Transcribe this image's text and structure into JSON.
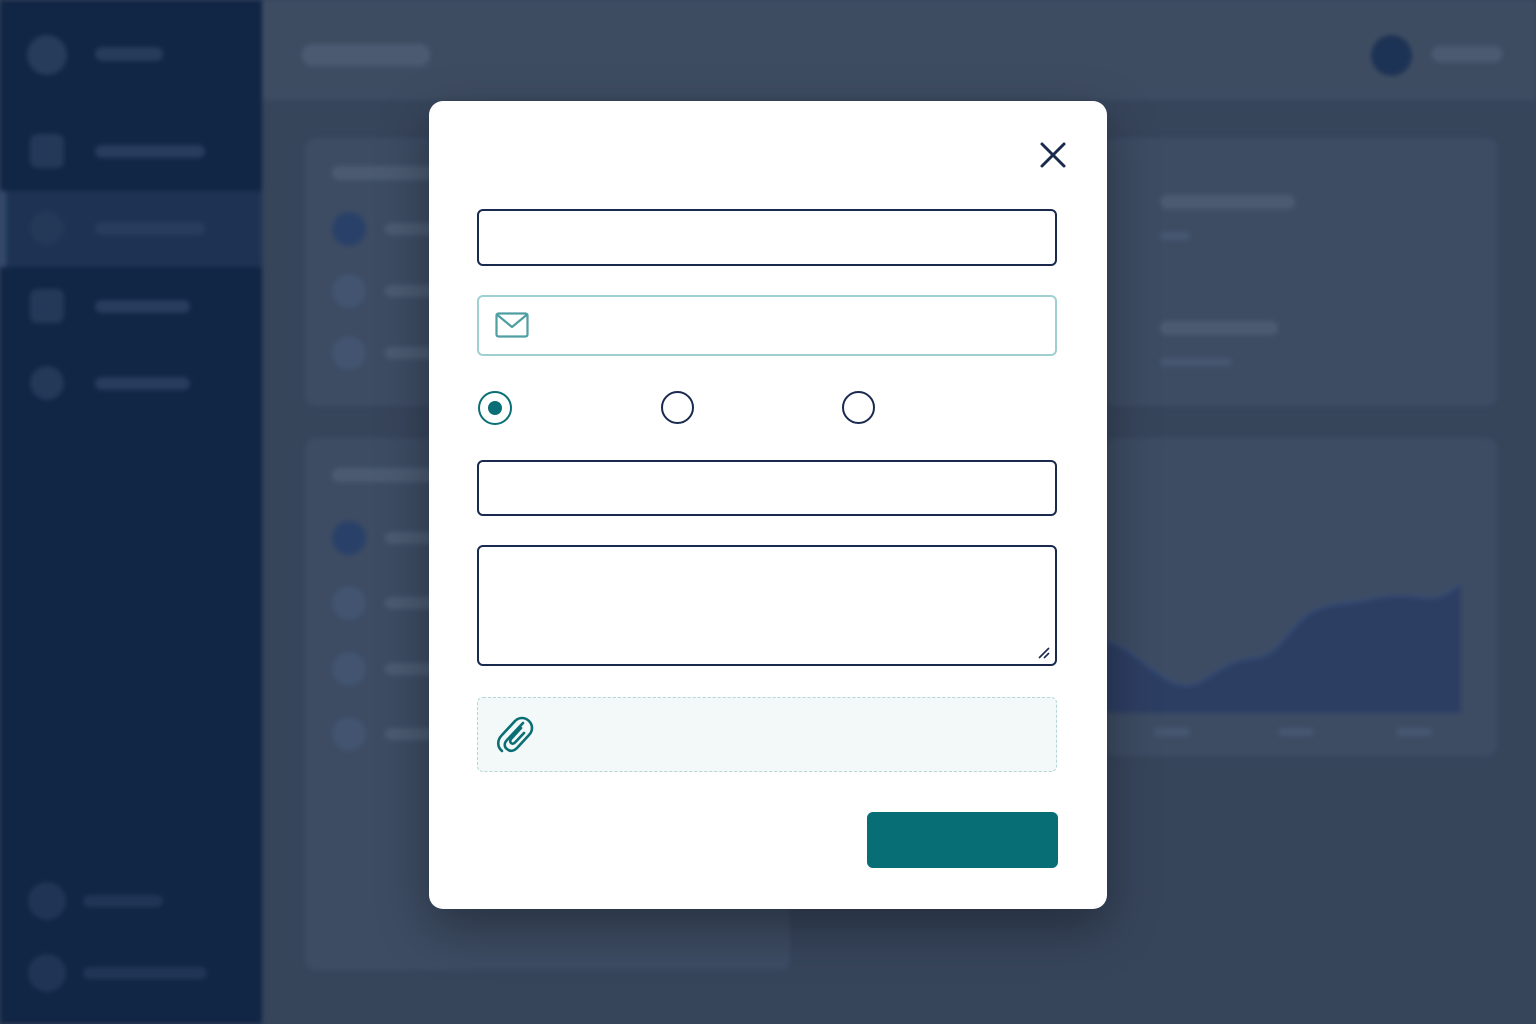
{
  "modal": {
    "close_icon": "close-icon",
    "name_field": {
      "value": "",
      "placeholder": ""
    },
    "email_field": {
      "icon": "envelope-icon",
      "value": "",
      "placeholder": ""
    },
    "radio_options": [
      {
        "label": "",
        "checked": true
      },
      {
        "label": "",
        "checked": false
      },
      {
        "label": "",
        "checked": false
      }
    ],
    "text_field": {
      "value": "",
      "placeholder": ""
    },
    "message_area": {
      "value": "",
      "placeholder": ""
    },
    "attachment": {
      "icon": "paperclip-icon",
      "label": ""
    },
    "submit_button": {
      "label": ""
    }
  },
  "colors": {
    "accent": "#086e75",
    "field_border": "#1a2a4f",
    "email_border": "#9fcfd0",
    "sidebar": "#0f2444",
    "overlay": "#3d4b60"
  }
}
